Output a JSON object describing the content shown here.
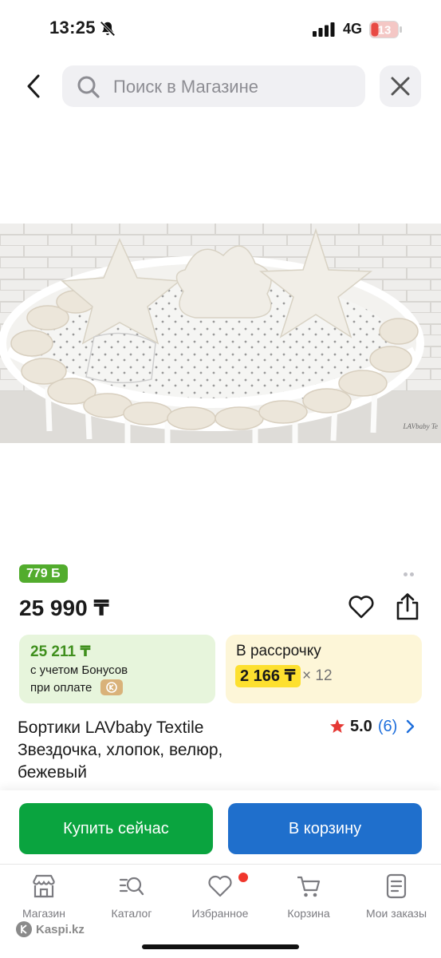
{
  "status": {
    "time": "13:25",
    "network": "4G",
    "battery": "13"
  },
  "search": {
    "placeholder": "Поиск в Магазине"
  },
  "product": {
    "image_watermark": "LAVbaby Te",
    "bonus_badge": "779 Б",
    "price": "25 990 ₸",
    "title": "Бортики LAVbaby Textile Звездочка, хлопок, велюр, бежевый",
    "rating": "5.0",
    "reviews": "(6)"
  },
  "bonus_card": {
    "amount": "25 211 ₸",
    "line1": "с учетом Бонусов",
    "line2": "при оплате"
  },
  "installment_card": {
    "title": "В рассрочку",
    "monthly": "2 166 ₸",
    "months": "× 12"
  },
  "actions": {
    "buy_now": "Купить сейчас",
    "add_to_cart": "В корзину"
  },
  "tabs": [
    {
      "label": "Магазин",
      "icon": "store-icon"
    },
    {
      "label": "Каталог",
      "icon": "catalog-search-icon"
    },
    {
      "label": "Избранное",
      "icon": "heart-icon"
    },
    {
      "label": "Корзина",
      "icon": "cart-icon"
    },
    {
      "label": "Мои заказы",
      "icon": "orders-icon"
    }
  ],
  "branding": "Kaspi.kz",
  "colors": {
    "bonus_green": "#52ac2d",
    "buy_green": "#0aa43f",
    "cart_blue": "#1f6fcc",
    "installment_yellow": "#fde02f",
    "star_red": "#e53935",
    "battery_red": "#e84a44"
  }
}
